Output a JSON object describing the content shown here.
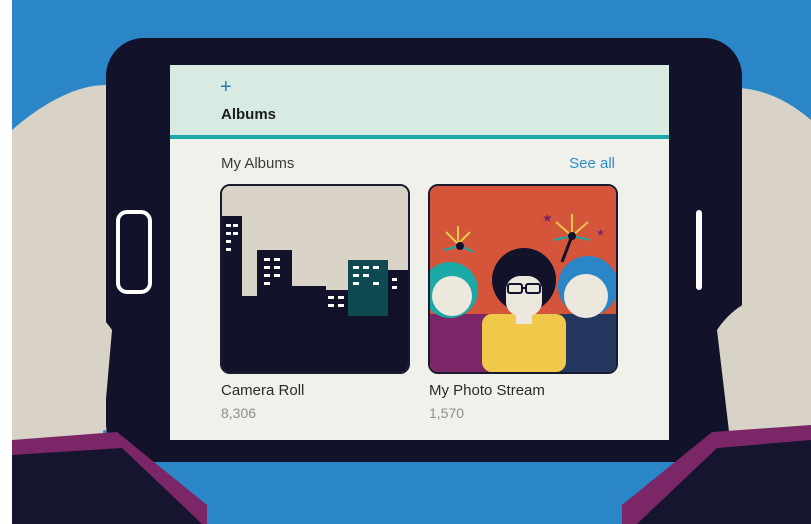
{
  "header": {
    "add_icon": "+",
    "title": "Albums"
  },
  "section": {
    "title": "My Albums",
    "see_all_label": "See all"
  },
  "albums": [
    {
      "name": "Camera Roll",
      "count": "8,306",
      "thumbnail": "city-skyline-illustration"
    },
    {
      "name": "My Photo Stream",
      "count": "1,570",
      "thumbnail": "friends-fireworks-illustration"
    }
  ],
  "colors": {
    "background": "#2a86c7",
    "tablet_bezel": "#12122a",
    "header_bg": "#d7ebe3",
    "accent_teal": "#1aa9a6",
    "link_blue": "#2d8ec8"
  }
}
